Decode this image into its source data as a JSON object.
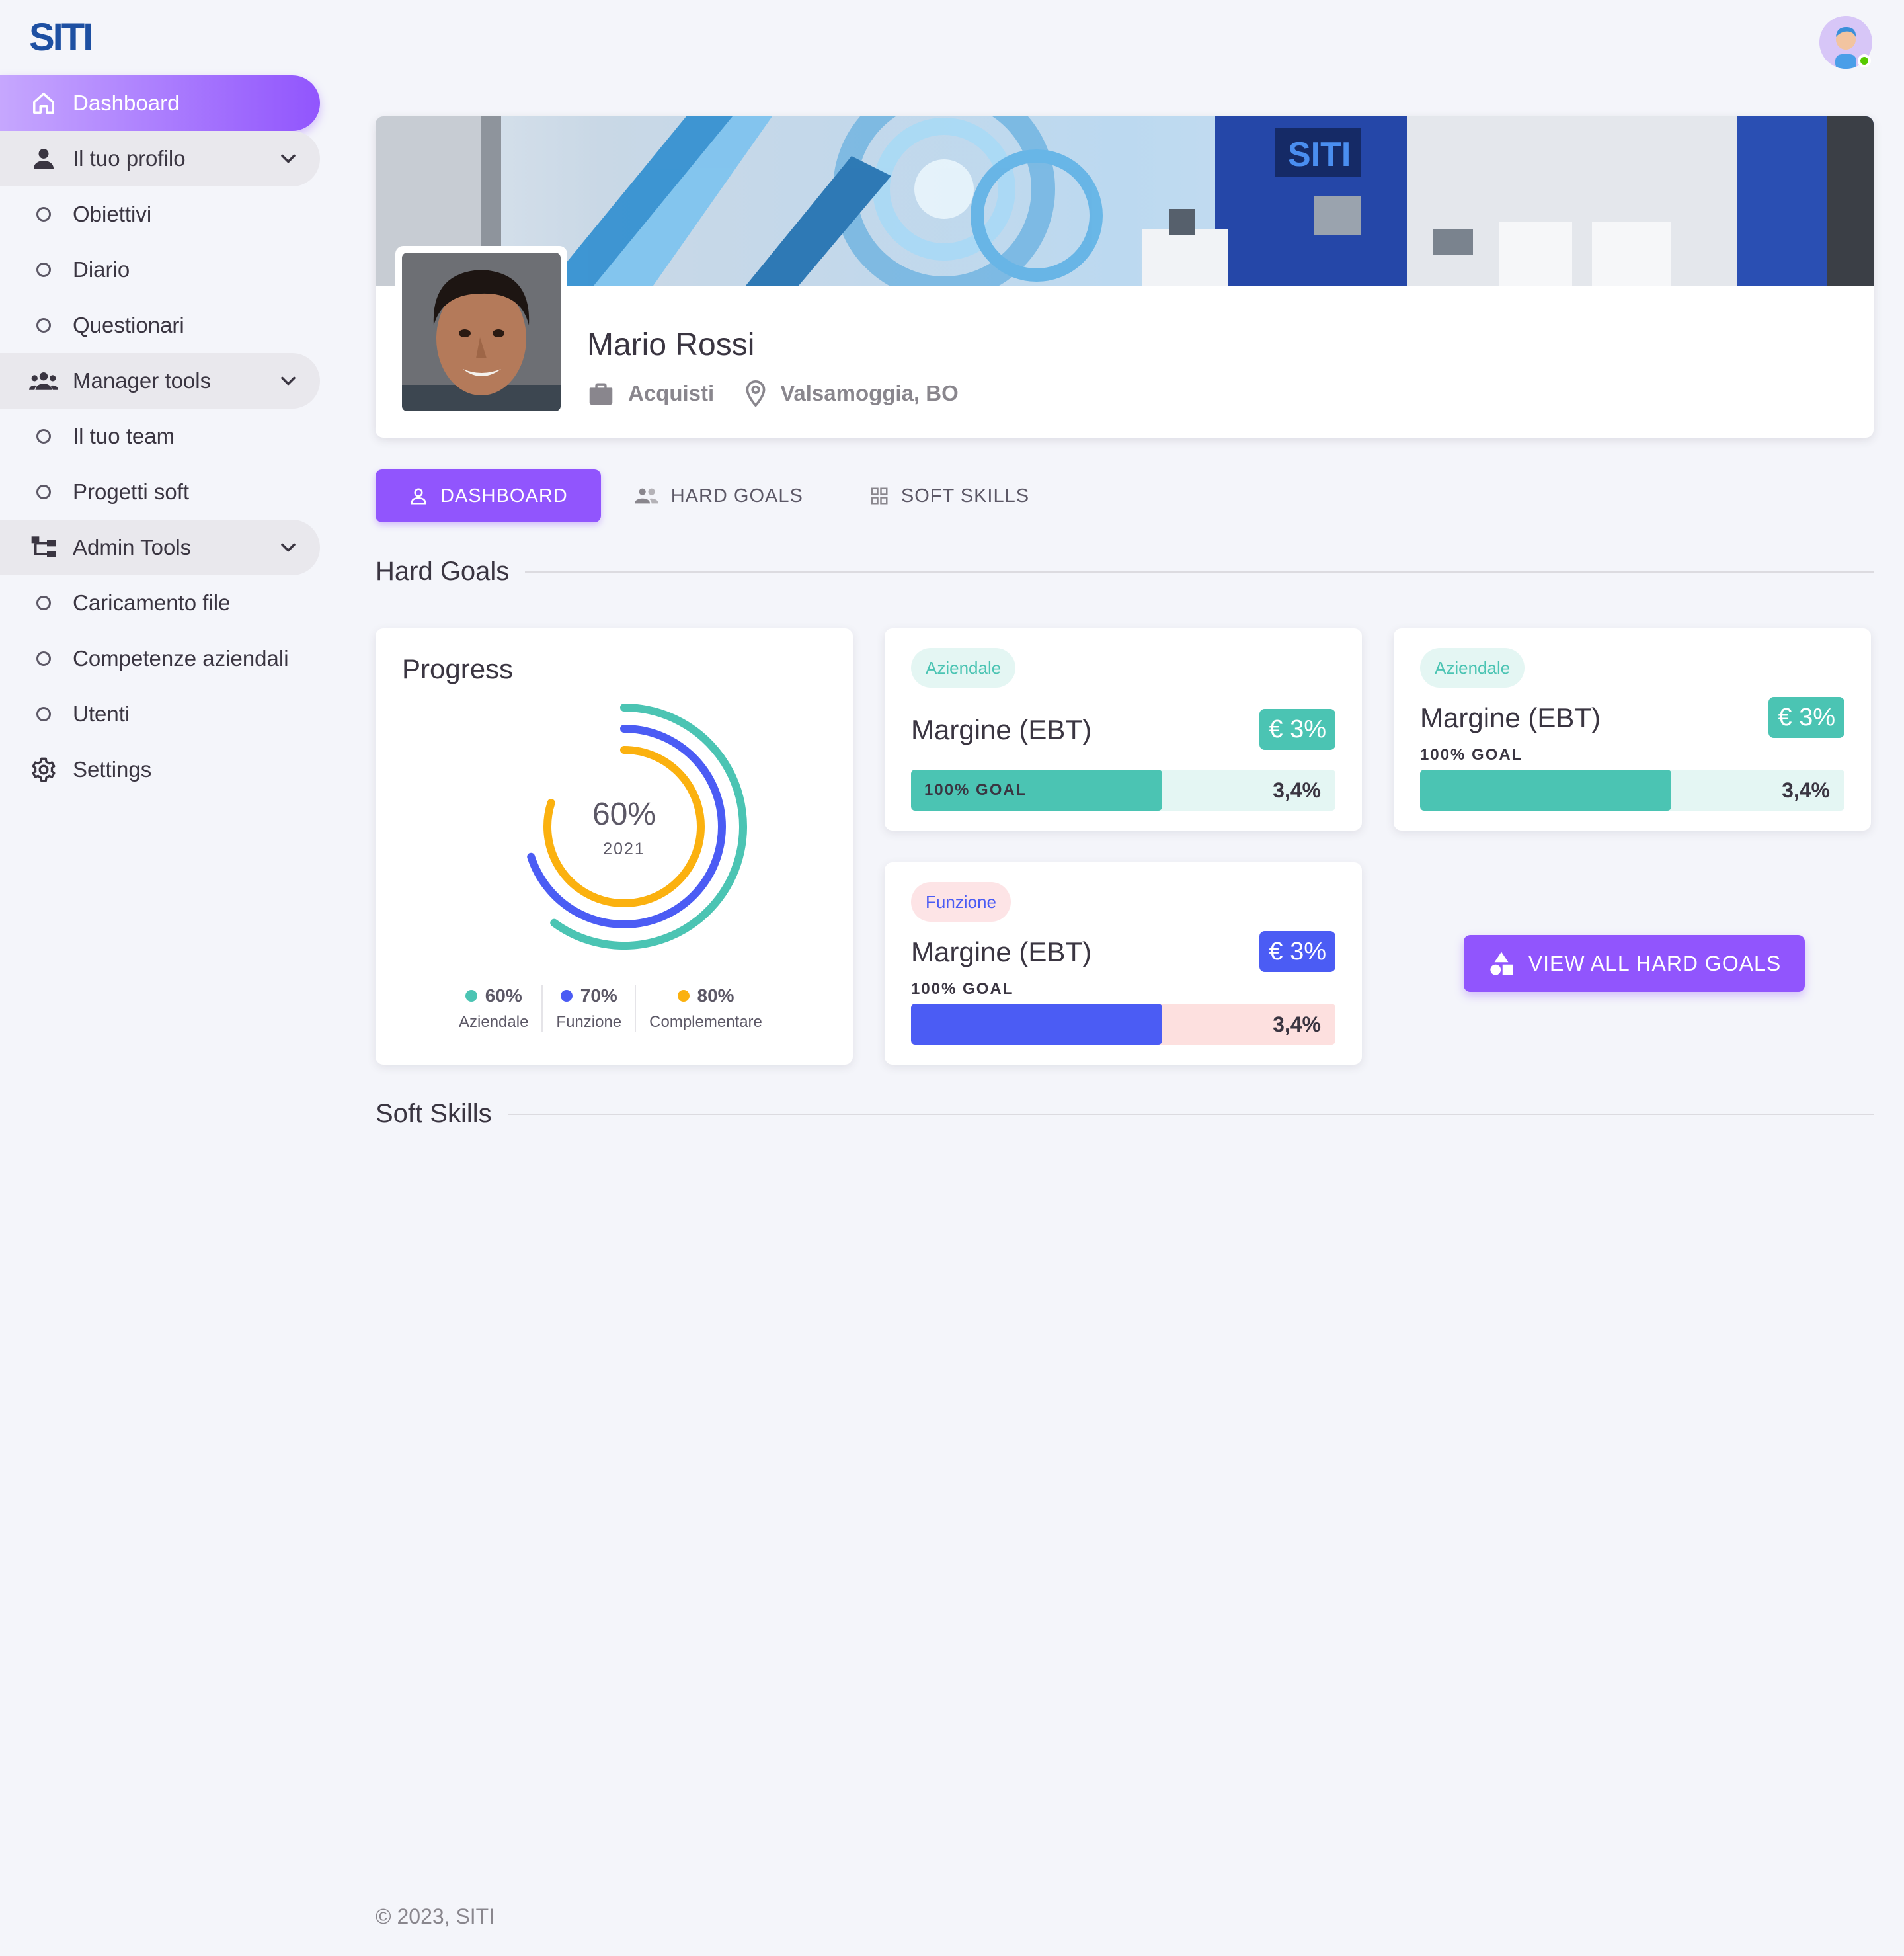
{
  "brand": {
    "logo_text": "SITI"
  },
  "sidebar": {
    "items": [
      {
        "label": "Dashboard",
        "icon": "home-icon",
        "type": "active"
      },
      {
        "label": "Il tuo profilo",
        "icon": "person-icon",
        "type": "group"
      },
      {
        "label": "Obiettivi",
        "icon": "circle-icon",
        "type": "child"
      },
      {
        "label": "Diario",
        "icon": "circle-icon",
        "type": "child"
      },
      {
        "label": "Questionari",
        "icon": "circle-icon",
        "type": "child"
      },
      {
        "label": "Manager tools",
        "icon": "group-icon",
        "type": "group"
      },
      {
        "label": "Il tuo team",
        "icon": "circle-icon",
        "type": "child"
      },
      {
        "label": "Progetti soft",
        "icon": "circle-icon",
        "type": "child"
      },
      {
        "label": "Admin Tools",
        "icon": "hierarchy-icon",
        "type": "group"
      },
      {
        "label": "Caricamento file",
        "icon": "circle-icon",
        "type": "child"
      },
      {
        "label": "Competenze aziendali",
        "icon": "circle-icon",
        "type": "child"
      },
      {
        "label": "Utenti",
        "icon": "circle-icon",
        "type": "child"
      },
      {
        "label": "Settings",
        "icon": "gear-icon",
        "type": "plain"
      }
    ]
  },
  "profile": {
    "name": "Mario Rossi",
    "department": "Acquisti",
    "location": "Valsamoggia, BO",
    "banner_brand_text": "SITI"
  },
  "tabs": [
    {
      "label": "DASHBOARD",
      "icon": "person-outline-icon",
      "active": true
    },
    {
      "label": "HARD GOALS",
      "icon": "people-icon",
      "active": false
    },
    {
      "label": "SOFT SKILLS",
      "icon": "grid-icon",
      "active": false
    }
  ],
  "sections": {
    "hard_goals": "Hard Goals",
    "soft_skills": "Soft Skills"
  },
  "progress": {
    "title": "Progress",
    "center_value": "60%",
    "center_year": "2021",
    "legend": [
      {
        "value": "60%",
        "name": "Aziendale",
        "color": "#4bc4b3"
      },
      {
        "value": "70%",
        "name": "Funzione",
        "color": "#4b5cf4"
      },
      {
        "value": "80%",
        "name": "Complementare",
        "color": "#fbb10f"
      }
    ]
  },
  "chart_data": {
    "type": "radial-bar",
    "title": "Progress",
    "center_label": "60%",
    "center_sublabel": "2021",
    "series": [
      {
        "name": "Aziendale",
        "value": 60,
        "color": "#4bc4b3"
      },
      {
        "name": "Funzione",
        "value": 70,
        "color": "#4b5cf4"
      },
      {
        "name": "Complementare",
        "value": 80,
        "color": "#fbb10f"
      }
    ]
  },
  "goals": [
    {
      "chip": "Aziendale",
      "title": "Margine (EBT)",
      "badge": "€ 3%",
      "goal_label": "100% GOAL",
      "value": "3,4%",
      "progress": 0.59,
      "label_inside": true,
      "color": "#4bc4b3",
      "track": "#e4f6f3",
      "chip_bg": "#e4f6f3",
      "chip_color": "#4bc4b3"
    },
    {
      "chip": "Aziendale",
      "title": "Margine (EBT)",
      "badge": "€ 3%",
      "goal_label": "100% GOAL",
      "value": "3,4%",
      "progress": 0.59,
      "label_inside": false,
      "color": "#4bc4b3",
      "track": "#e4f6f3",
      "chip_bg": "#e4f6f3",
      "chip_color": "#4bc4b3"
    },
    {
      "chip": "Funzione",
      "title": "Margine (EBT)",
      "badge": "€ 3%",
      "goal_label": "100% GOAL",
      "value": "3,4%",
      "progress": 0.59,
      "label_inside": false,
      "color": "#4b5cf4",
      "track": "#fde0df",
      "chip_bg": "#fde4e6",
      "chip_color": "#4b5cf4"
    }
  ],
  "view_all_label": "VIEW ALL HARD GOALS",
  "footer": "© 2023, SITI"
}
